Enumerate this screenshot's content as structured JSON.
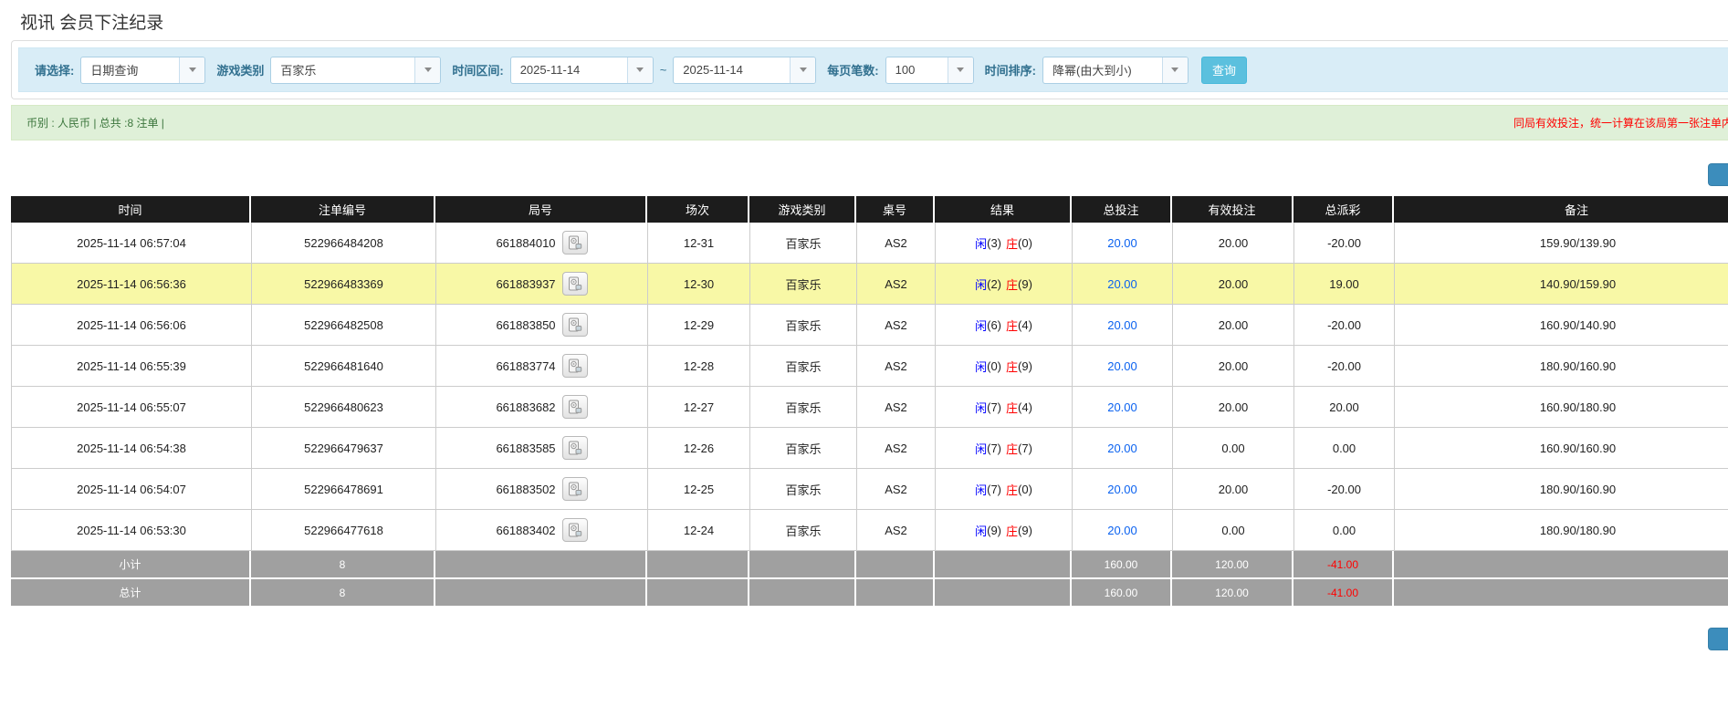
{
  "page_title": "视讯 会员下注纪录",
  "filters": {
    "select_label": "请选择:",
    "select_value": "日期查询",
    "game_type_label": "游戏类别",
    "game_type_value": "百家乐",
    "time_range_label": "时间区间:",
    "date_from": "2025-11-14",
    "range_separator": "~",
    "date_to": "2025-11-14",
    "page_size_label": "每页笔数:",
    "page_size_value": "100",
    "sort_label": "时间排序:",
    "sort_value": "降幂(由大到小)",
    "query_button": "查询"
  },
  "summary_bar": {
    "info": "币别 : 人民币 | 总共 :8 注单 |",
    "notice": "同局有效投注，统一计算在该局第一张注单内"
  },
  "colors": {
    "accent_blue": "#5bc0de",
    "player_blue": "#0000ff",
    "banker_red": "#ff0000",
    "amount_blue": "#0b62f0",
    "negative_red": "#ff0000",
    "highlight_yellow": "#f8f8a6",
    "header_black": "#1c1c1c",
    "footer_gray": "#a0a0a0",
    "summary_green_bg": "#dff0d8",
    "filter_bar_bg": "#d9edf7"
  },
  "table": {
    "headers": [
      "时间",
      "注单编号",
      "局号",
      "场次",
      "游戏类别",
      "桌号",
      "结果",
      "总投注",
      "有效投注",
      "总派彩",
      "备注"
    ],
    "video_icon": "video-icon",
    "rows": [
      {
        "time": "2025-11-14 06:57:04",
        "bet_id": "522966484208",
        "round_id": "661884010",
        "session": "12-31",
        "game": "百家乐",
        "table_no": "AS2",
        "player_label": "闲",
        "player_num": "(3)",
        "banker_label": "庄",
        "banker_num": "(0)",
        "total_bet": "20.00",
        "valid_bet": "20.00",
        "payout": "-20.00",
        "remark": "159.90/139.90",
        "highlight": false
      },
      {
        "time": "2025-11-14 06:56:36",
        "bet_id": "522966483369",
        "round_id": "661883937",
        "session": "12-30",
        "game": "百家乐",
        "table_no": "AS2",
        "player_label": "闲",
        "player_num": "(2)",
        "banker_label": "庄",
        "banker_num": "(9)",
        "total_bet": "20.00",
        "valid_bet": "20.00",
        "payout": "19.00",
        "remark": "140.90/159.90",
        "highlight": true
      },
      {
        "time": "2025-11-14 06:56:06",
        "bet_id": "522966482508",
        "round_id": "661883850",
        "session": "12-29",
        "game": "百家乐",
        "table_no": "AS2",
        "player_label": "闲",
        "player_num": "(6)",
        "banker_label": "庄",
        "banker_num": "(4)",
        "total_bet": "20.00",
        "valid_bet": "20.00",
        "payout": "-20.00",
        "remark": "160.90/140.90",
        "highlight": false
      },
      {
        "time": "2025-11-14 06:55:39",
        "bet_id": "522966481640",
        "round_id": "661883774",
        "session": "12-28",
        "game": "百家乐",
        "table_no": "AS2",
        "player_label": "闲",
        "player_num": "(0)",
        "banker_label": "庄",
        "banker_num": "(9)",
        "total_bet": "20.00",
        "valid_bet": "20.00",
        "payout": "-20.00",
        "remark": "180.90/160.90",
        "highlight": false
      },
      {
        "time": "2025-11-14 06:55:07",
        "bet_id": "522966480623",
        "round_id": "661883682",
        "session": "12-27",
        "game": "百家乐",
        "table_no": "AS2",
        "player_label": "闲",
        "player_num": "(7)",
        "banker_label": "庄",
        "banker_num": "(4)",
        "total_bet": "20.00",
        "valid_bet": "20.00",
        "payout": "20.00",
        "remark": "160.90/180.90",
        "highlight": false
      },
      {
        "time": "2025-11-14 06:54:38",
        "bet_id": "522966479637",
        "round_id": "661883585",
        "session": "12-26",
        "game": "百家乐",
        "table_no": "AS2",
        "player_label": "闲",
        "player_num": "(7)",
        "banker_label": "庄",
        "banker_num": "(7)",
        "total_bet": "20.00",
        "valid_bet": "0.00",
        "payout": "0.00",
        "remark": "160.90/160.90",
        "highlight": false
      },
      {
        "time": "2025-11-14 06:54:07",
        "bet_id": "522966478691",
        "round_id": "661883502",
        "session": "12-25",
        "game": "百家乐",
        "table_no": "AS2",
        "player_label": "闲",
        "player_num": "(7)",
        "banker_label": "庄",
        "banker_num": "(0)",
        "total_bet": "20.00",
        "valid_bet": "20.00",
        "payout": "-20.00",
        "remark": "180.90/160.90",
        "highlight": false
      },
      {
        "time": "2025-11-14 06:53:30",
        "bet_id": "522966477618",
        "round_id": "661883402",
        "session": "12-24",
        "game": "百家乐",
        "table_no": "AS2",
        "player_label": "闲",
        "player_num": "(9)",
        "banker_label": "庄",
        "banker_num": "(9)",
        "total_bet": "20.00",
        "valid_bet": "0.00",
        "payout": "0.00",
        "remark": "180.90/180.90",
        "highlight": false
      }
    ],
    "footer": [
      {
        "label": "小计",
        "count": "8",
        "total_bet": "160.00",
        "valid_bet": "120.00",
        "payout": "-41.00"
      },
      {
        "label": "总计",
        "count": "8",
        "total_bet": "160.00",
        "valid_bet": "120.00",
        "payout": "-41.00"
      }
    ]
  }
}
